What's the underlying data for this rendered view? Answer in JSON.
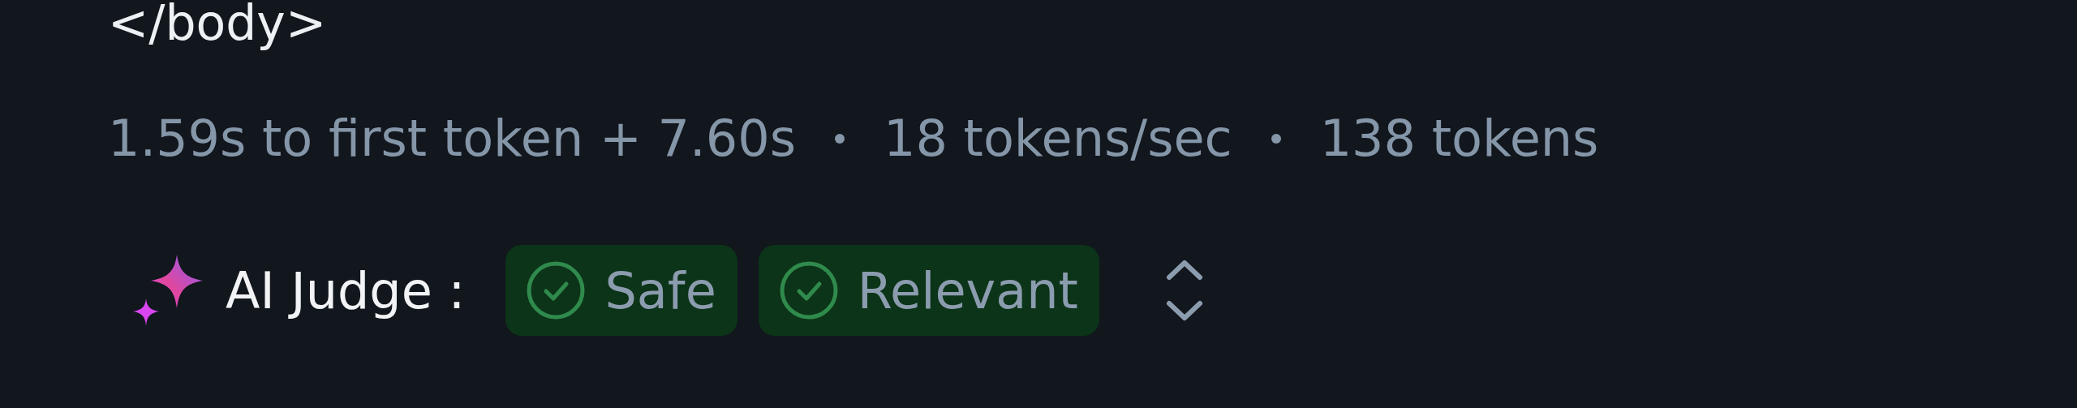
{
  "code_tail": "</body>",
  "stats": [
    "1.59s to first token + 7.60s",
    "18 tokens/sec",
    "138 tokens"
  ],
  "judge": {
    "label": "AI Judge :",
    "badges": [
      {
        "label": "Safe"
      },
      {
        "label": "Relevant"
      }
    ]
  }
}
